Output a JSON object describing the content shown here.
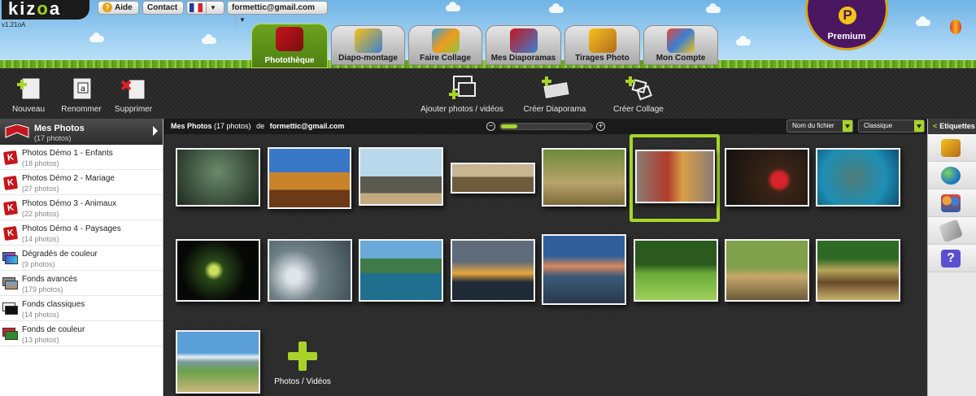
{
  "header": {
    "logo": "kizoa",
    "version": "v1.21oA",
    "help_label": "Aide",
    "contact_label": "Contact",
    "account_email": "formettic@gmail.com",
    "premium_label": "Premium",
    "premium_letter": "P"
  },
  "tabs": [
    {
      "label": "Photothèque",
      "active": true
    },
    {
      "label": "Diapo-montage"
    },
    {
      "label": "Faire Collage"
    },
    {
      "label": "Mes Diaporamas"
    },
    {
      "label": "Tirages Photo"
    },
    {
      "label": "Mon Compte"
    }
  ],
  "toolbar": {
    "new": "Nouveau",
    "rename": "Renommer",
    "delete": "Supprimer",
    "add_photos": "Ajouter photos / vidéos",
    "create_slideshow": "Créer Diaporama",
    "create_collage": "Créer Collage"
  },
  "sidebar": {
    "header_title": "Mes Photos",
    "header_count": "(17 photos)",
    "items": [
      {
        "title": "Photos Démo 1 - Enfants",
        "count": "(18 photos)"
      },
      {
        "title": "Photos Démo 2 - Mariage",
        "count": "(27 photos)"
      },
      {
        "title": "Photos Démo 3 - Animaux",
        "count": "(22 photos)"
      },
      {
        "title": "Photos Démo 4 - Paysages",
        "count": "(14 photos)"
      },
      {
        "title": "Dégradés de couleur",
        "count": "(9 photos)"
      },
      {
        "title": "Fonds avancés",
        "count": "(179 photos)"
      },
      {
        "title": "Fonds classiques",
        "count": "(14 photos)"
      },
      {
        "title": "Fonds de couleur",
        "count": "(13 photos)"
      }
    ]
  },
  "main": {
    "title": "Mes Photos",
    "count": "(17 photos)",
    "of": "de",
    "owner": "formettic@gmail.com",
    "sort_value": "Nom du fichier",
    "view_value": "Classique",
    "add_tile_label": "Photos / Vidéos",
    "zoom_level": 0.18
  },
  "right_sidebar": {
    "title": "Etiquettes"
  },
  "colors": {
    "accent": "#a9d32a",
    "premium": "#4a1760"
  }
}
